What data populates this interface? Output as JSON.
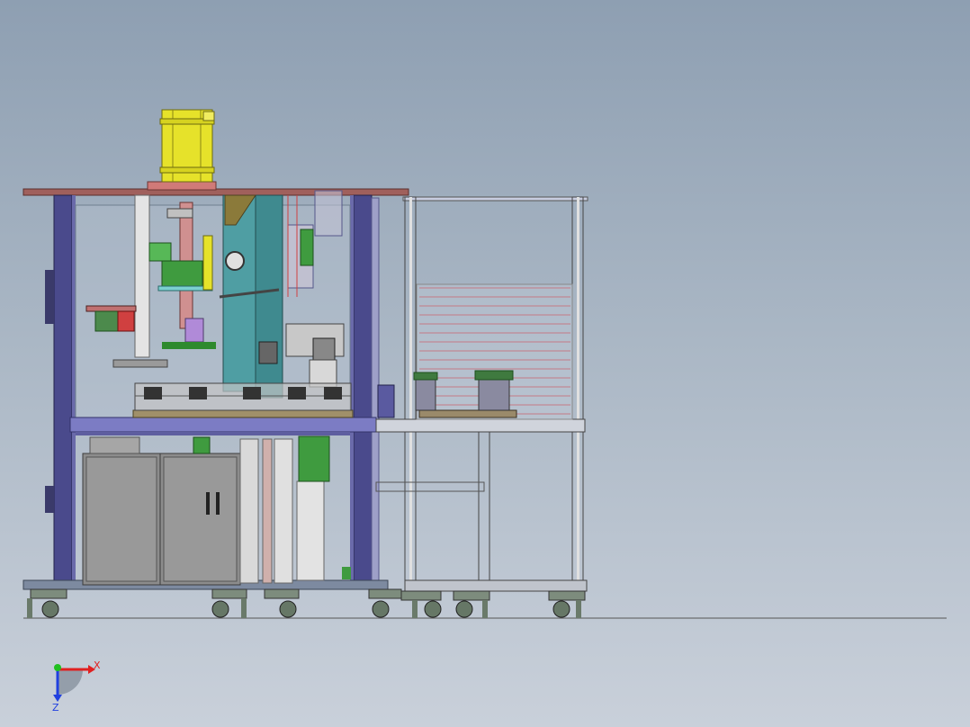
{
  "viewport": {
    "name": "graphics-area"
  },
  "triad": {
    "x_label": "X",
    "z_label": "Z"
  },
  "colors": {
    "background_top": "#8e9fb2",
    "frame_blue": "#4a4a8c",
    "cylinder_yellow": "#e6e22a",
    "table_top_red": "#a0605c",
    "plate_green": "#3f9b3f",
    "teal_slide": "#4f9ea3",
    "cabinet_gray": "#8c8c8c",
    "triad_x": "#e02020",
    "triad_y": "#20c020",
    "triad_z": "#2040e0"
  }
}
